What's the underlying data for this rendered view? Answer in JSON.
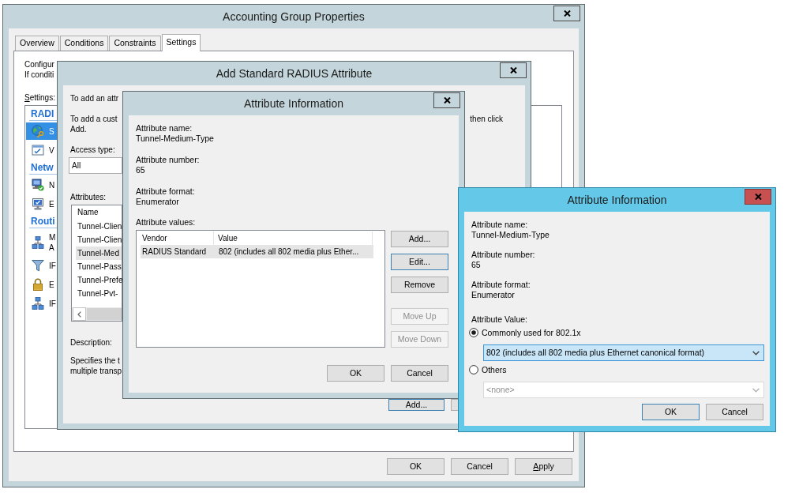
{
  "properties_window": {
    "title": "Accounting Group Properties",
    "active": false,
    "tabs": [
      {
        "label": "Overview",
        "selected": false
      },
      {
        "label": "Conditions",
        "selected": false
      },
      {
        "label": "Constraints",
        "selected": false
      },
      {
        "label": "Settings",
        "selected": true
      }
    ],
    "settings_tab": {
      "intro_lines": [
        "Configur",
        "If conditi"
      ],
      "settings_label": {
        "text": "Settings:",
        "mnemonic": true
      },
      "list": [
        {
          "kind": "heading",
          "text": "RADI"
        },
        {
          "kind": "item",
          "lines": [
            "S"
          ],
          "selected": true
        },
        {
          "kind": "item",
          "lines": [
            "V"
          ],
          "selected": false
        },
        {
          "kind": "heading",
          "text": "Netw"
        },
        {
          "kind": "item",
          "lines": [
            "N"
          ],
          "selected": false
        },
        {
          "kind": "item",
          "lines": [
            "E"
          ],
          "selected": false
        },
        {
          "kind": "heading",
          "text": "Routi"
        },
        {
          "kind": "item",
          "lines": [
            "M",
            "A"
          ],
          "selected": false
        },
        {
          "kind": "item",
          "lines": [
            "IF"
          ],
          "selected": false
        },
        {
          "kind": "item",
          "lines": [
            "E"
          ],
          "selected": false
        },
        {
          "kind": "item",
          "lines": [
            "IF"
          ],
          "selected": false
        }
      ]
    },
    "buttons": [
      {
        "label": "OK",
        "mnemonic": false
      },
      {
        "label": "Cancel",
        "mnemonic": false
      },
      {
        "label": "Apply",
        "mnemonic": true
      }
    ]
  },
  "add_attribute_dialog": {
    "title": "Add Standard RADIUS Attribute",
    "active": false,
    "intro": "To add an attr",
    "custom_note": {
      "start_lines": [
        "To add a cust",
        "Add."
      ],
      "end": "then click"
    },
    "access_type": {
      "label": "Access type:",
      "value": "All"
    },
    "attributes": {
      "label": "Attributes:",
      "column": "Name",
      "rows": [
        {
          "name": "Tunnel-Clien",
          "selected": false
        },
        {
          "name": "Tunnel-Clien",
          "selected": false
        },
        {
          "name": "Tunnel-Med",
          "selected": true
        },
        {
          "name": "Tunnel-Pass",
          "selected": false
        },
        {
          "name": "Tunnel-Prefe",
          "selected": false
        },
        {
          "name": "Tunnel-Pvt-",
          "selected": false
        }
      ]
    },
    "description": {
      "label": "Description:",
      "lines": [
        "Specifies the t",
        "multiple transp"
      ]
    },
    "buttons": [
      {
        "label": "Add...",
        "default": true,
        "covered": false
      },
      {
        "default": false,
        "covered": true
      }
    ]
  },
  "attribute_info_dialog": {
    "title": "Attribute Information",
    "active": false,
    "fields": [
      {
        "label": "Attribute name:",
        "value": "Tunnel-Medium-Type"
      },
      {
        "label": "Attribute number:",
        "value": "65"
      },
      {
        "label": "Attribute format:",
        "value": "Enumerator"
      }
    ],
    "values_label": "Attribute values:",
    "values_table": {
      "columns": [
        "Vendor",
        "Value"
      ],
      "rows": [
        {
          "cells": [
            "RADIUS Standard",
            "802 (includes all 802 media plus Ether..."
          ],
          "selected": true
        }
      ]
    },
    "side_buttons": [
      {
        "label": "Add...",
        "default": false,
        "disabled": false
      },
      {
        "label": "Edit...",
        "default": true,
        "disabled": false
      },
      {
        "label": "Remove",
        "default": false,
        "disabled": false
      },
      {
        "label": "Move Up",
        "default": false,
        "disabled": true
      },
      {
        "label": "Move Down",
        "default": false,
        "disabled": true
      }
    ],
    "buttons": [
      {
        "label": "OK"
      },
      {
        "label": "Cancel"
      }
    ]
  },
  "attribute_value_dialog": {
    "title": "Attribute Information",
    "active": true,
    "fields": [
      {
        "label": "Attribute name:",
        "value": "Tunnel-Medium-Type"
      },
      {
        "label": "Attribute number:",
        "value": "65"
      },
      {
        "label": "Attribute format:",
        "value": "Enumerator"
      }
    ],
    "value_label": "Attribute Value:",
    "options": [
      {
        "label": "Commonly used for 802.1x",
        "selected": true,
        "dropdown": {
          "value": "802 (includes all 802 media plus Ethernet canonical format)",
          "focused": true,
          "disabled": false
        }
      },
      {
        "label": "Others",
        "selected": false,
        "dropdown": {
          "value": "<none>",
          "focused": false,
          "disabled": true
        }
      }
    ],
    "buttons": [
      {
        "label": "OK",
        "default": true
      },
      {
        "label": "Cancel",
        "default": false
      }
    ]
  }
}
